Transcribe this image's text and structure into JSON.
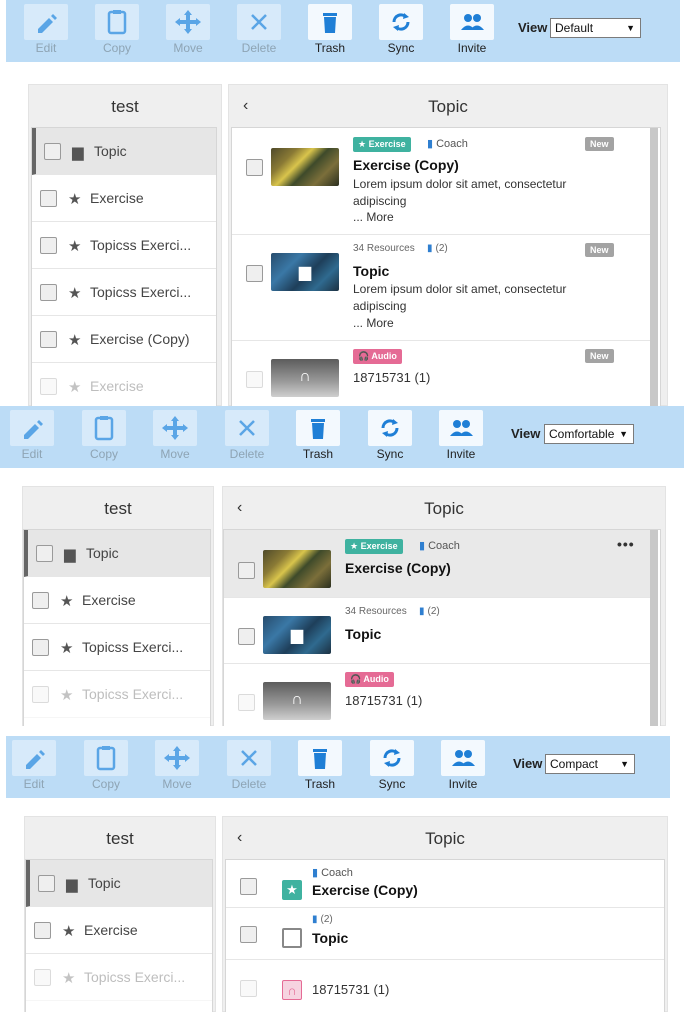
{
  "toolbar": {
    "edit": "Edit",
    "copy": "Copy",
    "move": "Move",
    "delete": "Delete",
    "trash": "Trash",
    "sync": "Sync",
    "invite": "Invite",
    "view_label": "View"
  },
  "views": [
    "Default",
    "Comfortable",
    "Compact"
  ],
  "tree": {
    "title": "test",
    "items": [
      "Topic",
      "Exercise",
      "Topicss Exerci...",
      "Topicss Exerci...",
      "Exercise (Copy)",
      "Exercise"
    ]
  },
  "content": {
    "title": "Topic",
    "back_icon": "chevron-left-icon",
    "tag_exercise": "Exercise",
    "tag_audio": "Audio",
    "coach": "Coach",
    "resources": "34 Resources",
    "resources_short": "(2)",
    "new": "New",
    "exercise_title": "Exercise (Copy)",
    "topic_title": "Topic",
    "audio_title": "18715731 (1)",
    "desc_line1": "Lorem ipsum dolor sit amet, consectetur",
    "desc_line2": "adipiscing",
    "more": "... More",
    "menu_dots": "•••"
  },
  "colors": {
    "toolbar_bg": "#bcdcf6",
    "icon_blue": "#2f7fd0",
    "exercise_tag": "#3fb2a0",
    "audio_tag": "#e56b95",
    "new_tag": "#a3a3a3"
  }
}
